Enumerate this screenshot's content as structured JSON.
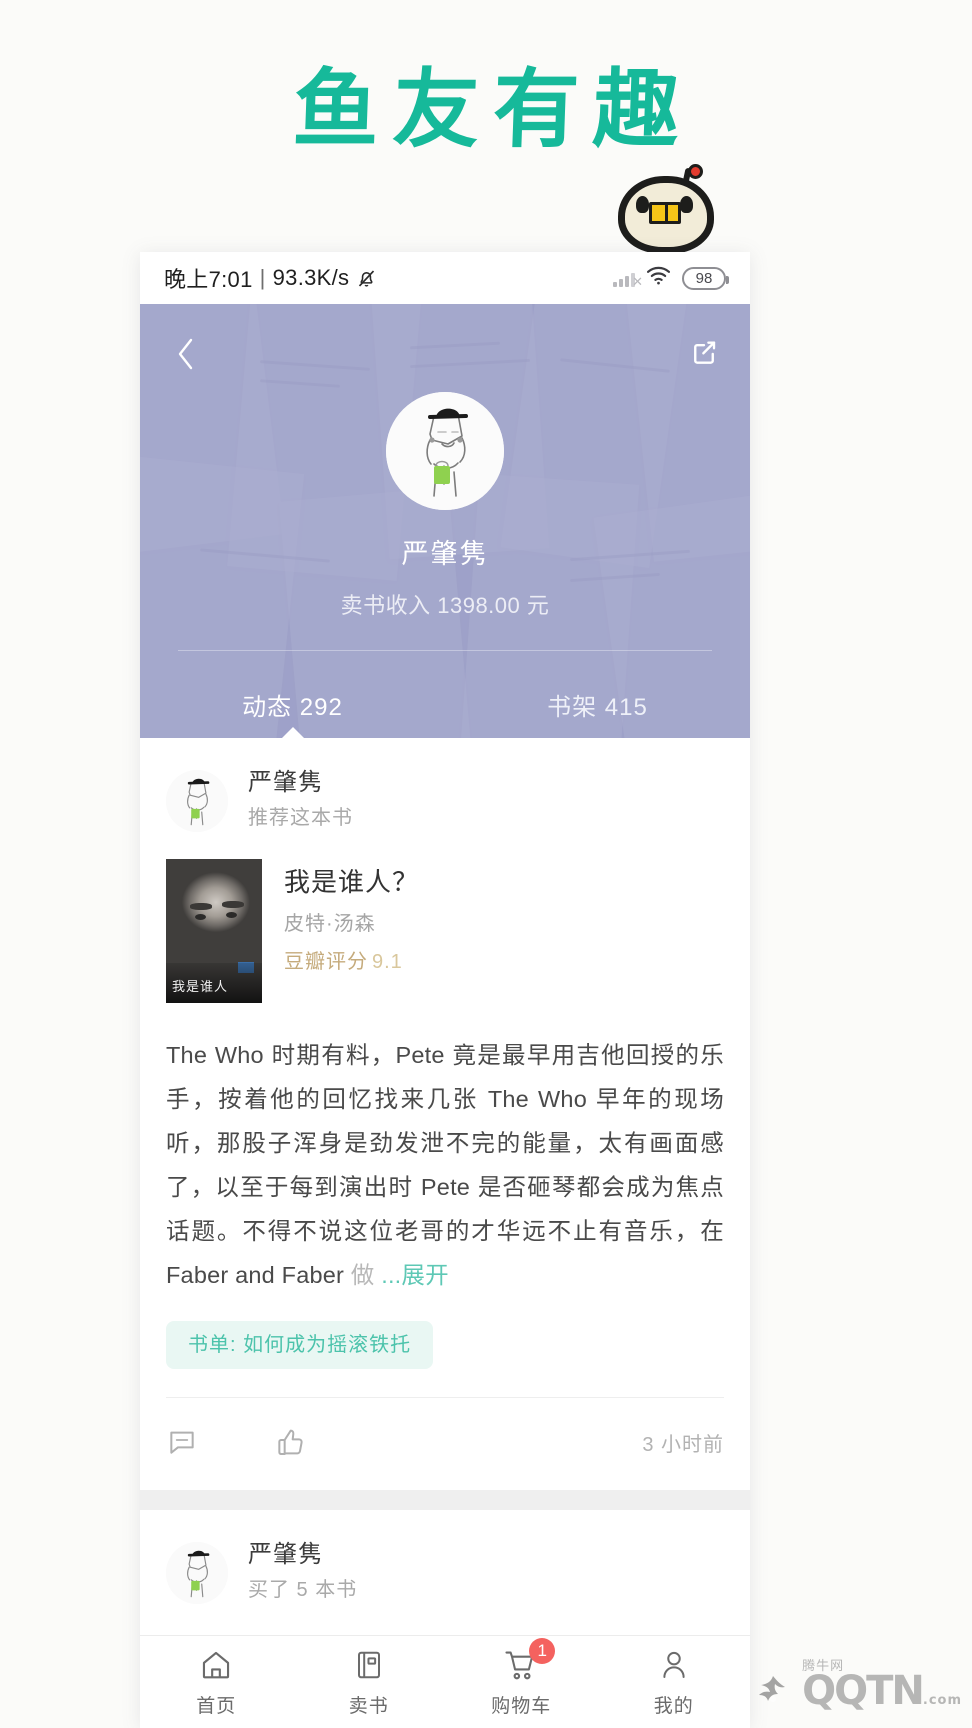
{
  "promo": {
    "headline": "鱼友有趣",
    "accent_color": "#16b99a",
    "mascot_icon": "book-mascot-sticker"
  },
  "status_bar": {
    "time": "晚上7:01",
    "separator": "|",
    "network_speed": "93.3K/s",
    "mute_icon": "bell-mute-icon",
    "signal_icon": "signal-bars-icon",
    "wifi_icon": "wifi-icon",
    "battery_level": "98"
  },
  "profile": {
    "back_icon": "chevron-left-icon",
    "share_icon": "share-external-icon",
    "avatar_icon": "user-avatar-illustration",
    "name": "严肇隽",
    "income": "卖书收入 1398.00 元",
    "header_color": "#a9acd0",
    "tabs": [
      {
        "label": "动态 292",
        "active": true
      },
      {
        "label": "书架 415",
        "active": false
      }
    ]
  },
  "post": {
    "author": "严肇隽",
    "action": "推荐这本书",
    "avatar_icon": "user-avatar-illustration",
    "book": {
      "cover_icon": "book-cover-photo",
      "cover_caption": "我是谁人",
      "title": "我是谁人？",
      "author": "皮特·汤森",
      "rating_label": "豆瓣评分",
      "rating_value": "9.1",
      "rating_color": "#c5ab7c"
    },
    "body_lines": [
      "The Who 时期有料，Pete 竟是最早用吉他回授的乐手，",
      "按着他的回忆找来几张 The Who 早年的现场听，那股子",
      "浑身是劲发泄不完的能量，太有画面感了，以至于每到",
      "演出时 Pete 是否砸琴都会成为焦点话题。不得不说这位",
      "老哥的才华远不止有音乐，在 Faber and Faber "
    ],
    "body_faded": "做 ",
    "body_more": "...展开",
    "tag": "书单: 如何成为摇滚铁托",
    "tag_color": "#4cc3ab",
    "comment_icon": "comment-bubble-icon",
    "like_icon": "thumbs-up-icon",
    "time": "3 小时前"
  },
  "post2": {
    "author": "严肇隽",
    "action": "买了 5 本书",
    "avatar_icon": "user-avatar-illustration"
  },
  "tabbar": {
    "items": [
      {
        "label": "首页",
        "icon": "home-icon",
        "badge": ""
      },
      {
        "label": "卖书",
        "icon": "book-icon",
        "badge": ""
      },
      {
        "label": "购物车",
        "icon": "shopping-cart-icon",
        "badge": "1"
      },
      {
        "label": "我的",
        "icon": "person-icon",
        "badge": ""
      }
    ],
    "badge_color": "#f4625f"
  },
  "watermark": {
    "text": "QQTN",
    "suffix": ".com",
    "sub": "腾牛网"
  }
}
